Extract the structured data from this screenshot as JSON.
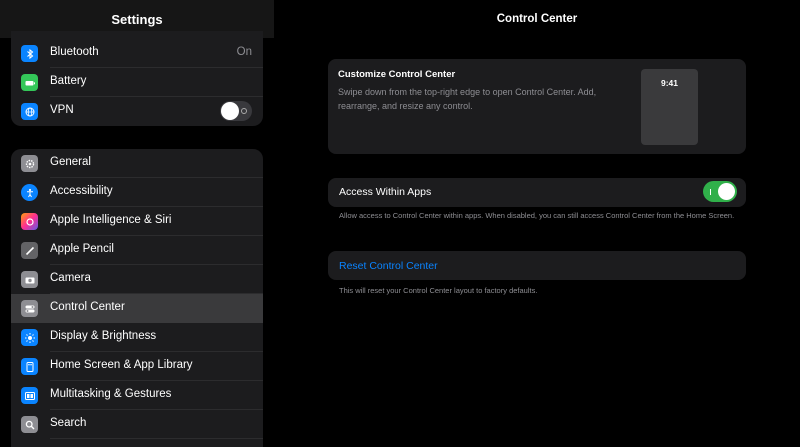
{
  "sidebar": {
    "title": "Settings",
    "group1": [
      {
        "label": "Bluetooth",
        "value": "On",
        "icon": "bluetooth-icon",
        "color": "#0a84ff"
      },
      {
        "label": "Battery",
        "icon": "battery-icon",
        "color": "#34c759"
      },
      {
        "label": "VPN",
        "icon": "globe-icon",
        "color": "#0a84ff",
        "toggle": "off"
      }
    ],
    "group2": [
      {
        "label": "General",
        "icon": "gear-icon",
        "color": "#8e8e93"
      },
      {
        "label": "Accessibility",
        "icon": "accessibility-icon",
        "color": "#0a84ff"
      },
      {
        "label": "Apple Intelligence & Siri",
        "icon": "siri-icon",
        "color": "#ff9f0a"
      },
      {
        "label": "Apple Pencil",
        "icon": "pencil-icon",
        "color": "#636366"
      },
      {
        "label": "Camera",
        "icon": "camera-icon",
        "color": "#8e8e93"
      },
      {
        "label": "Control Center",
        "icon": "toggles-icon",
        "color": "#8e8e93",
        "selected": true
      },
      {
        "label": "Display & Brightness",
        "icon": "sun-icon",
        "color": "#0a84ff"
      },
      {
        "label": "Home Screen & App Library",
        "icon": "home-screen-icon",
        "color": "#0a84ff"
      },
      {
        "label": "Multitasking & Gestures",
        "icon": "multitasking-icon",
        "color": "#0a84ff"
      },
      {
        "label": "Search",
        "icon": "search-icon",
        "color": "#8e8e93"
      }
    ]
  },
  "detail": {
    "title": "Control Center",
    "customize": {
      "heading": "Customize Control Center",
      "description": "Swipe down from the top-right edge to open Control Center. Add, rearrange, and resize any control.",
      "preview_time": "9:41"
    },
    "access": {
      "label": "Access Within Apps",
      "toggle": "on",
      "footnote": "Allow access to Control Center within apps. When disabled, you can still access Control Center from the Home Screen."
    },
    "reset": {
      "label": "Reset Control Center",
      "footnote": "This will reset your Control Center layout to factory defaults."
    }
  },
  "colors": {
    "accent": "#0a84ff",
    "toggle_on": "#30b04a"
  }
}
